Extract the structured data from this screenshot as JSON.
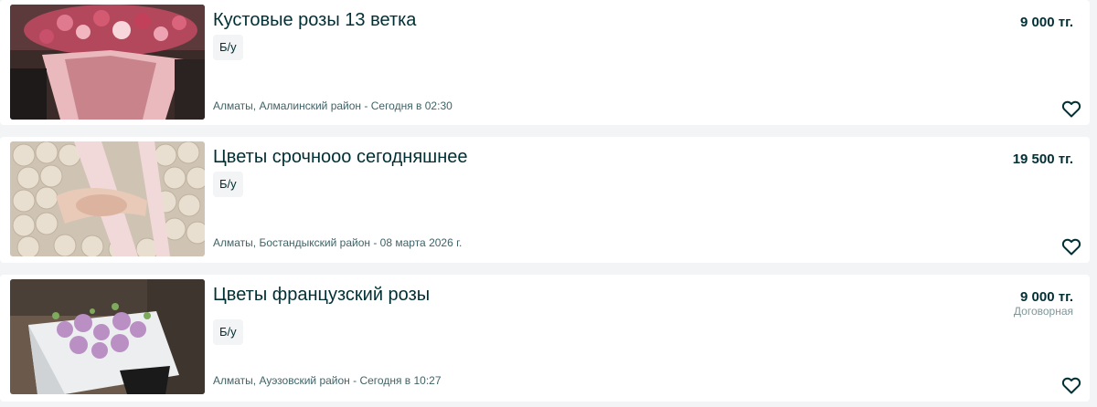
{
  "listings": [
    {
      "title": "Кустовые розы 13 ветка",
      "condition": "Б/у",
      "location_date": "Алматы, Алмалинский район - Сегодня в 02:30",
      "price": "9 000 тг.",
      "negotiable": "",
      "image": "bouquet-spray-roses-photo",
      "fav_icon": "heart-outline-icon"
    },
    {
      "title": "Цветы срочнооо сегодняшнее",
      "condition": "Б/у",
      "location_date": "Алматы, Бостандыкский район - 08 марта 2026 г.",
      "price": "19 500 тг.",
      "negotiable": "",
      "image": "flower-box-white-chrysanthemums-photo",
      "fav_icon": "heart-outline-icon"
    },
    {
      "title": "Цветы французский розы",
      "condition": "Б/у",
      "location_date": "Алматы, Ауэзовский район - Сегодня в 10:27",
      "price": "9 000 тг.",
      "negotiable": "Договорная",
      "image": "bouquet-lisianthus-bag-photo",
      "fav_icon": "heart-outline-icon"
    }
  ],
  "colors": {
    "text": "#002f34",
    "muted": "#406367",
    "background": "#f2f4f5",
    "card": "#ffffff"
  }
}
